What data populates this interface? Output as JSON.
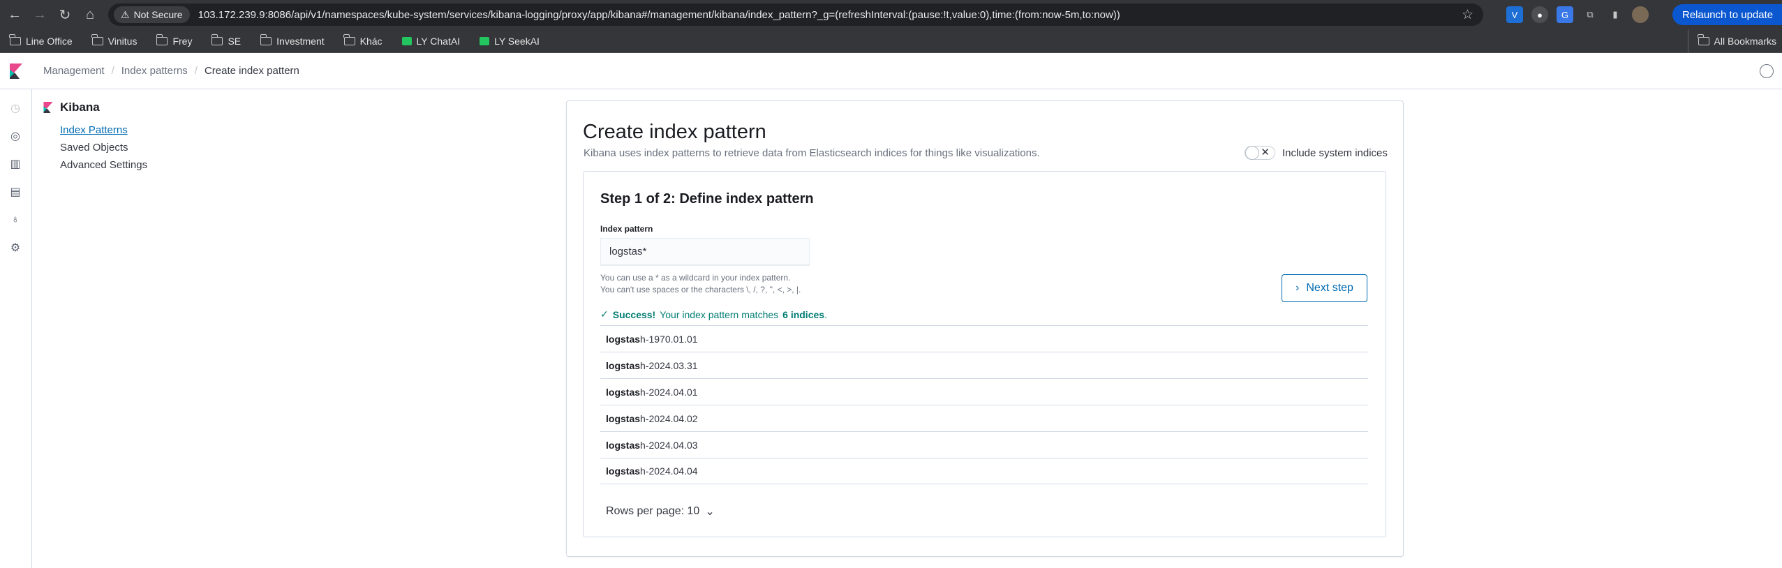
{
  "browser": {
    "not_secure": "Not Secure",
    "url": "103.172.239.9:8086/api/v1/namespaces/kube-system/services/kibana-logging/proxy/app/kibana#/management/kibana/index_pattern?_g=(refreshInterval:(pause:!t,value:0),time:(from:now-5m,to:now))",
    "relaunch": "Relaunch to update"
  },
  "bookmarks": [
    {
      "label": "Line Office",
      "icon": "folder-icon"
    },
    {
      "label": "Vinitus",
      "icon": "folder-icon"
    },
    {
      "label": "Frey",
      "icon": "folder-icon"
    },
    {
      "label": "SE",
      "icon": "folder-icon"
    },
    {
      "label": "Investment",
      "icon": "folder-icon"
    },
    {
      "label": "Khác",
      "icon": "folder-icon"
    },
    {
      "label": "LY ChatAI",
      "icon": "chat-icon"
    },
    {
      "label": "LY SeekAI",
      "icon": "chat-icon"
    }
  ],
  "all_bookmarks": "All Bookmarks",
  "breadcrumbs": [
    "Management",
    "Index patterns",
    "Create index pattern"
  ],
  "sidebar": {
    "title": "Kibana",
    "links": [
      "Index Patterns",
      "Saved Objects",
      "Advanced Settings"
    ]
  },
  "main": {
    "title": "Create index pattern",
    "description": "Kibana uses index patterns to retrieve data from Elasticsearch indices for things like visualizations.",
    "system_toggle_label": "Include system indices",
    "step_title": "Step 1 of 2: Define index pattern",
    "field_label": "Index pattern",
    "field_value": "logstas*",
    "help_line1": "You can use a * as a wildcard in your index pattern.",
    "help_line2": "You can't use spaces or the characters \\, /, ?, \", <, >, |.",
    "next_button": "Next step",
    "success_strong": "Success!",
    "success_text": "Your index pattern matches",
    "success_count": "6 indices",
    "success_end": ".",
    "indices": [
      {
        "match": "logstas",
        "rest": "h-1970.01.01"
      },
      {
        "match": "logstas",
        "rest": "h-2024.03.31"
      },
      {
        "match": "logstas",
        "rest": "h-2024.04.01"
      },
      {
        "match": "logstas",
        "rest": "h-2024.04.02"
      },
      {
        "match": "logstas",
        "rest": "h-2024.04.03"
      },
      {
        "match": "logstas",
        "rest": "h-2024.04.04"
      }
    ],
    "rows_per_page": "Rows per page: 10"
  },
  "colors": {
    "accent": "#006bb4",
    "success": "#017d73",
    "chrome_bg": "#35363a"
  }
}
